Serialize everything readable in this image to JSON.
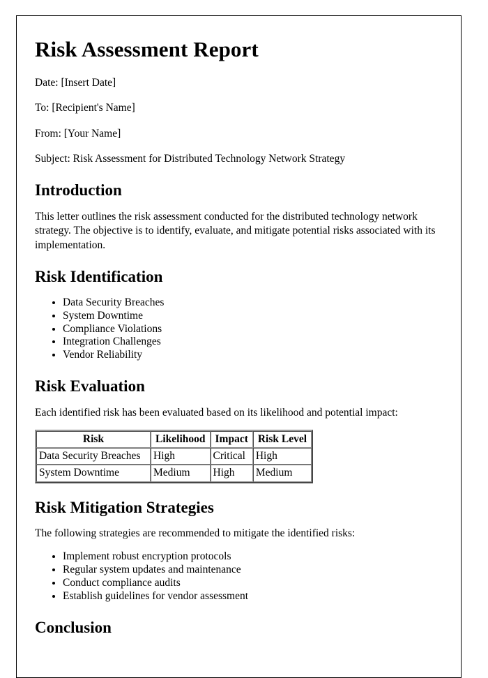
{
  "document": {
    "title": "Risk Assessment Report",
    "meta": {
      "date_line": "Date: [Insert Date]",
      "to_line": "To: [Recipient's Name]",
      "from_line": "From: [Your Name]",
      "subject_line": "Subject: Risk Assessment for Distributed Technology Network Strategy"
    },
    "sections": {
      "introduction": {
        "heading": "Introduction",
        "paragraph": "This letter outlines the risk assessment conducted for the distributed technology network strategy. The objective is to identify, evaluate, and mitigate potential risks associated with its implementation."
      },
      "risk_identification": {
        "heading": "Risk Identification",
        "items": [
          "Data Security Breaches",
          "System Downtime",
          "Compliance Violations",
          "Integration Challenges",
          "Vendor Reliability"
        ]
      },
      "risk_evaluation": {
        "heading": "Risk Evaluation",
        "paragraph": "Each identified risk has been evaluated based on its likelihood and potential impact:",
        "table": {
          "headers": [
            "Risk",
            "Likelihood",
            "Impact",
            "Risk Level"
          ],
          "rows": [
            [
              "Data Security Breaches",
              "High",
              "Critical",
              "High"
            ],
            [
              "System Downtime",
              "Medium",
              "High",
              "Medium"
            ]
          ]
        }
      },
      "risk_mitigation": {
        "heading": "Risk Mitigation Strategies",
        "paragraph": "The following strategies are recommended to mitigate the identified risks:",
        "items": [
          "Implement robust encryption protocols",
          "Regular system updates and maintenance",
          "Conduct compliance audits",
          "Establish guidelines for vendor assessment"
        ]
      },
      "conclusion": {
        "heading": "Conclusion"
      }
    }
  }
}
